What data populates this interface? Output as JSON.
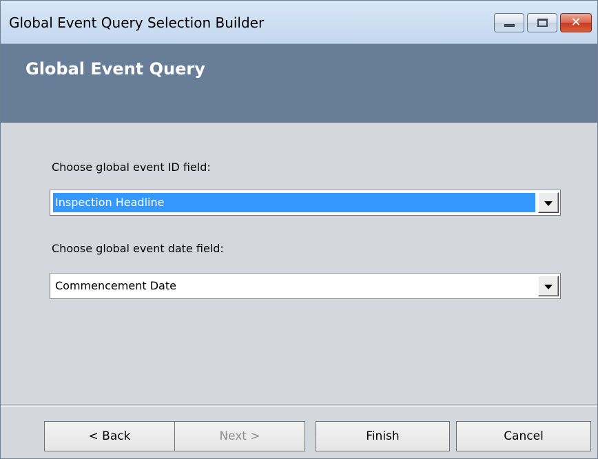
{
  "window": {
    "title": "Global Event Query Selection Builder",
    "caption_buttons": {
      "minimize_icon": "minimize-icon",
      "maximize_icon": "maximize-icon",
      "close_glyph": "✕"
    }
  },
  "header": {
    "title": "Global Event Query"
  },
  "form": {
    "id_field": {
      "label": "Choose global event ID field:",
      "selected": "Inspection Headline"
    },
    "date_field": {
      "label": "Choose global event date field:",
      "selected": "Commencement Date"
    }
  },
  "footer": {
    "back_label": "< Back",
    "next_label": "Next >",
    "finish_label": "Finish",
    "cancel_label": "Cancel"
  },
  "colors": {
    "banner": "#687e98",
    "selection": "#3399ff",
    "close_button": "#c7391e"
  }
}
